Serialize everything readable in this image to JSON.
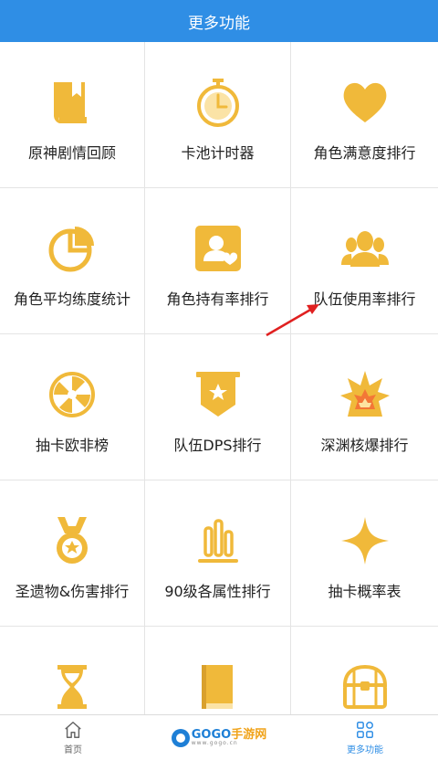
{
  "header": {
    "title": "更多功能"
  },
  "accent_color": "#f0b93a",
  "header_color": "#2f8ee5",
  "grid": {
    "items": [
      {
        "label": "原神剧情回顾",
        "icon": "book-icon"
      },
      {
        "label": "卡池计时器",
        "icon": "stopwatch-icon"
      },
      {
        "label": "角色满意度排行",
        "icon": "heart-icon"
      },
      {
        "label": "角色平均练度统计",
        "icon": "pie-chart-icon"
      },
      {
        "label": "角色持有率排行",
        "icon": "user-heart-icon"
      },
      {
        "label": "队伍使用率排行",
        "icon": "group-icon"
      },
      {
        "label": "抽卡欧非榜",
        "icon": "wheel-icon"
      },
      {
        "label": "队伍DPS排行",
        "icon": "star-banner-icon"
      },
      {
        "label": "深渊核爆排行",
        "icon": "explosion-icon"
      },
      {
        "label": "圣遗物&伤害排行",
        "icon": "medal-icon"
      },
      {
        "label": "90级各属性排行",
        "icon": "bar-chart-icon"
      },
      {
        "label": "抽卡概率表",
        "icon": "sparkle-icon"
      },
      {
        "label": "",
        "icon": "hourglass-icon"
      },
      {
        "label": "",
        "icon": "closed-book-icon"
      },
      {
        "label": "",
        "icon": "treasure-chest-icon"
      }
    ]
  },
  "tabbar": {
    "home_label": "首页",
    "logo_text_main": "GOGO",
    "logo_text_accent": "手游网",
    "logo_text_sub": "www.gogo.cn",
    "more_label": "更多功能"
  }
}
